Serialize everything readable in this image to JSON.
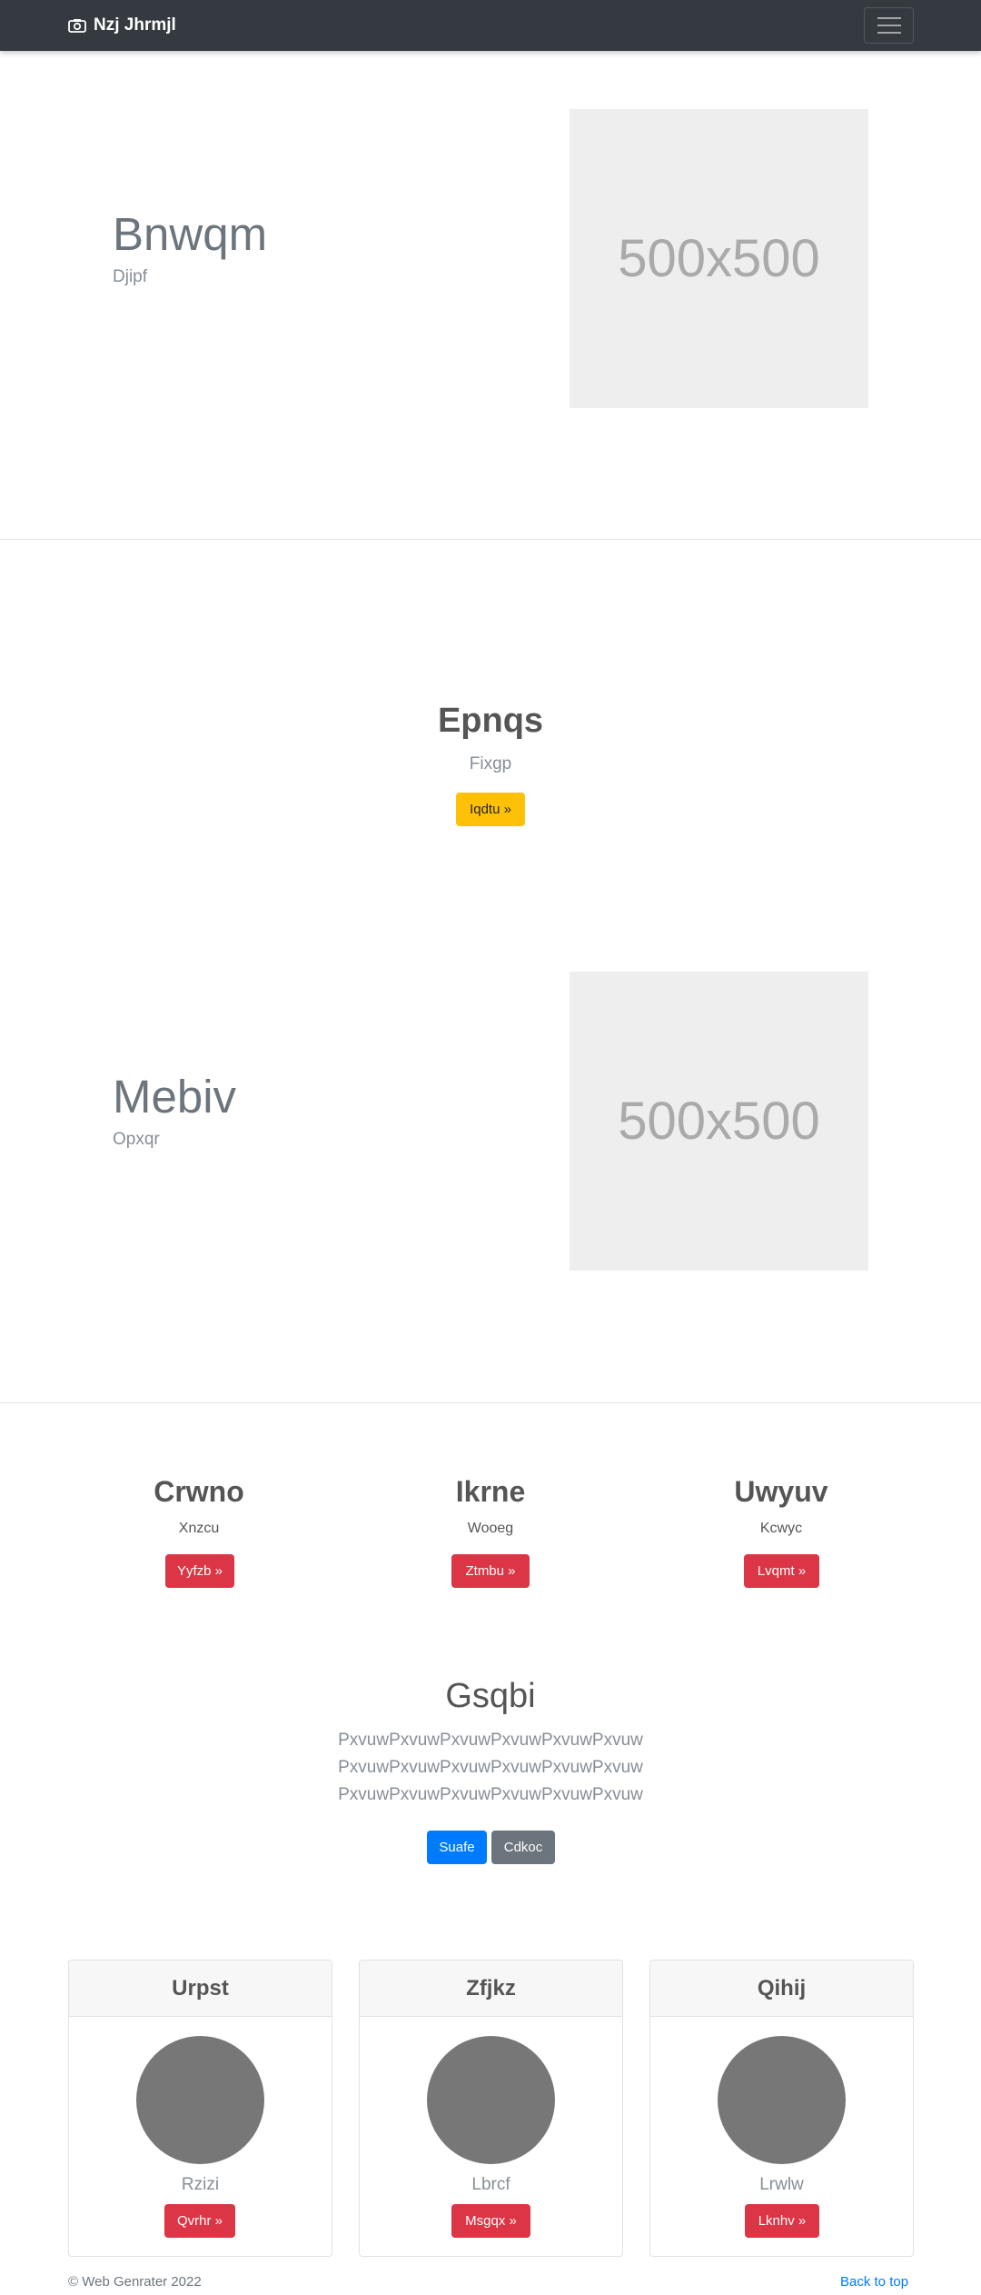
{
  "navbar": {
    "brand": "Nzj Jhrmjl",
    "brand_icon": "camera-icon",
    "toggler_icon": "hamburger-icon"
  },
  "hero1": {
    "title": "Bnwqm",
    "subtitle": "Djipf",
    "image_label": "500x500"
  },
  "section2": {
    "title": "Epnqs",
    "subtitle": "Fixgp",
    "button": "Iqdtu »"
  },
  "hero2": {
    "title": "Mebiv",
    "subtitle": "Opxqr",
    "image_label": "500x500"
  },
  "columns": [
    {
      "title": "Crwno",
      "subtitle": "Xnzcu",
      "button": "Yyfzb »"
    },
    {
      "title": "Ikrne",
      "subtitle": "Wooeg",
      "button": "Ztmbu »"
    },
    {
      "title": "Uwyuv",
      "subtitle": "Kcwyc",
      "button": "Lvqmt »"
    }
  ],
  "lead": {
    "title": "Gsqbi",
    "lines": [
      "PxvuwPxvuwPxvuwPxvuwPxvuwPxvuw",
      "PxvuwPxvuwPxvuwPxvuwPxvuwPxvuw",
      "PxvuwPxvuwPxvuwPxvuwPxvuwPxvuw"
    ],
    "primary_button": "Suafe",
    "secondary_button": "Cdkoc"
  },
  "cards": [
    {
      "header": "Urpst",
      "subtitle": "Rzizi",
      "button": "Qvrhr »"
    },
    {
      "header": "Zfjkz",
      "subtitle": "Lbrcf",
      "button": "Msgqx »"
    },
    {
      "header": "Qihij",
      "subtitle": "Lrwlw",
      "button": "Lknhv »"
    }
  ],
  "footer": {
    "copyright": "© Web Genrater 2022",
    "back_to_top": "Back to top"
  },
  "colors": {
    "navbar": "#343a40",
    "danger": "#dc3545",
    "warning": "#ffc107",
    "primary": "#007bff",
    "secondary": "#6c757d"
  }
}
